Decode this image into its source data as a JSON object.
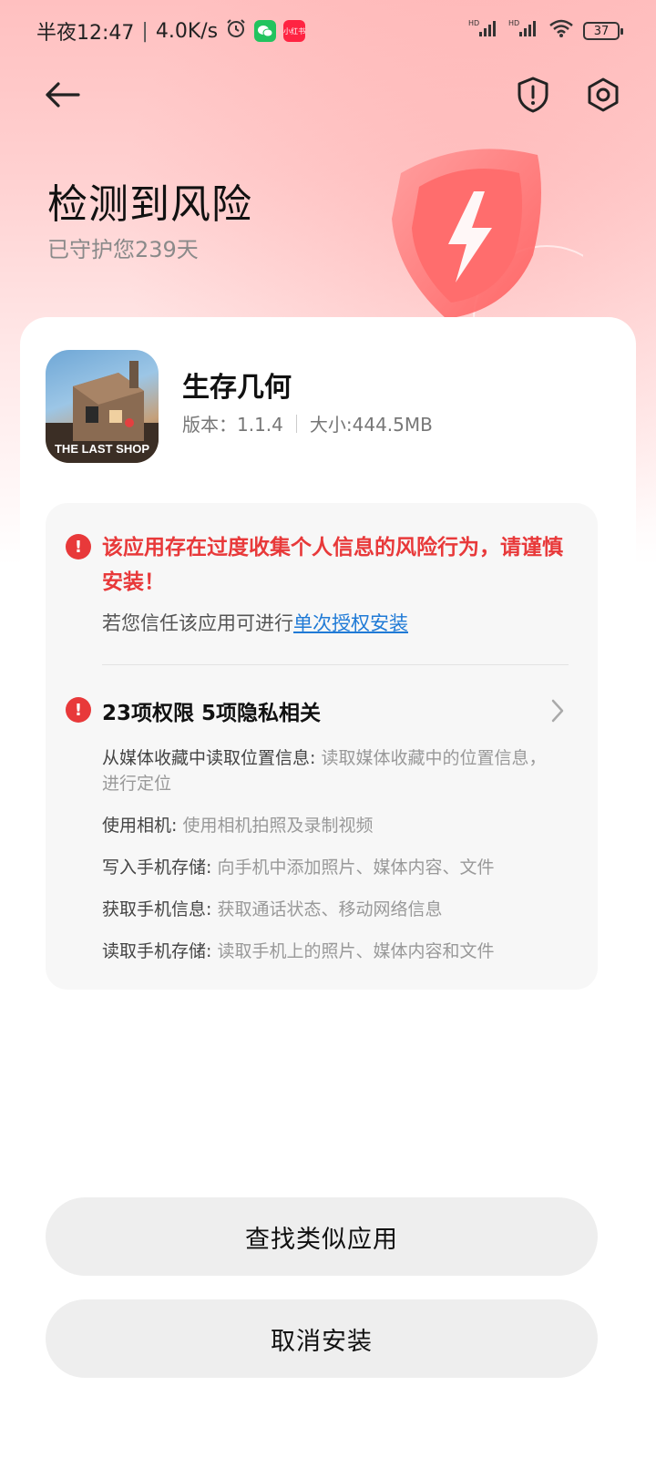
{
  "status_bar": {
    "time": "半夜12:47",
    "speed": "4.0K/s",
    "app_badge": "小红书",
    "battery": "37"
  },
  "page": {
    "title": "检测到风险",
    "protected_days": "已守护您239天"
  },
  "app": {
    "name": "生存几何",
    "icon_text": "THE LAST SHOP",
    "version": "版本：1.1.4",
    "size": "大小:444.5MB"
  },
  "risk": {
    "title": "该应用存在过度收集个人信息的风险行为，请谨慎安装！",
    "trust_prefix": "若您信任该应用可进行",
    "trust_link": "单次授权安装",
    "permissions_summary": "23项权限 5项隐私相关",
    "permissions": [
      {
        "name": "从媒体收藏中读取位置信息:",
        "desc": " 读取媒体收藏中的位置信息，进行定位"
      },
      {
        "name": "使用相机:",
        "desc": " 使用相机拍照及录制视频"
      },
      {
        "name": "写入手机存储:",
        "desc": " 向手机中添加照片、媒体内容、文件"
      },
      {
        "name": "获取手机信息:",
        "desc": " 获取通话状态、移动网络信息"
      },
      {
        "name": "读取手机存储:",
        "desc": " 读取手机上的照片、媒体内容和文件"
      }
    ]
  },
  "buttons": {
    "find_similar": "查找类似应用",
    "cancel_install": "取消安装"
  },
  "colors": {
    "danger": "#e8393a",
    "link": "#1f7ad6",
    "button_bg": "#eeeeee"
  }
}
